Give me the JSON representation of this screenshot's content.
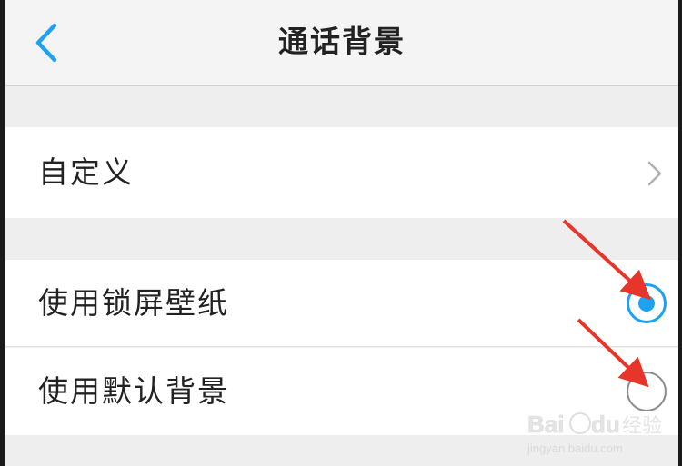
{
  "nav": {
    "title": "通话背景",
    "back_icon": "chevron-left-icon",
    "accent_color": "#1da1f2"
  },
  "rows": {
    "custom": {
      "label": "自定义",
      "trailing_icon": "chevron-right-icon"
    },
    "lock_screen": {
      "label": "使用锁屏壁纸",
      "selected": true
    },
    "default_bg": {
      "label": "使用默认背景",
      "selected": false
    }
  },
  "annotation": {
    "arrow_color": "#e8352a"
  },
  "watermark": {
    "brand": "Baidu经验",
    "url": "jingyan.baidu.com"
  }
}
